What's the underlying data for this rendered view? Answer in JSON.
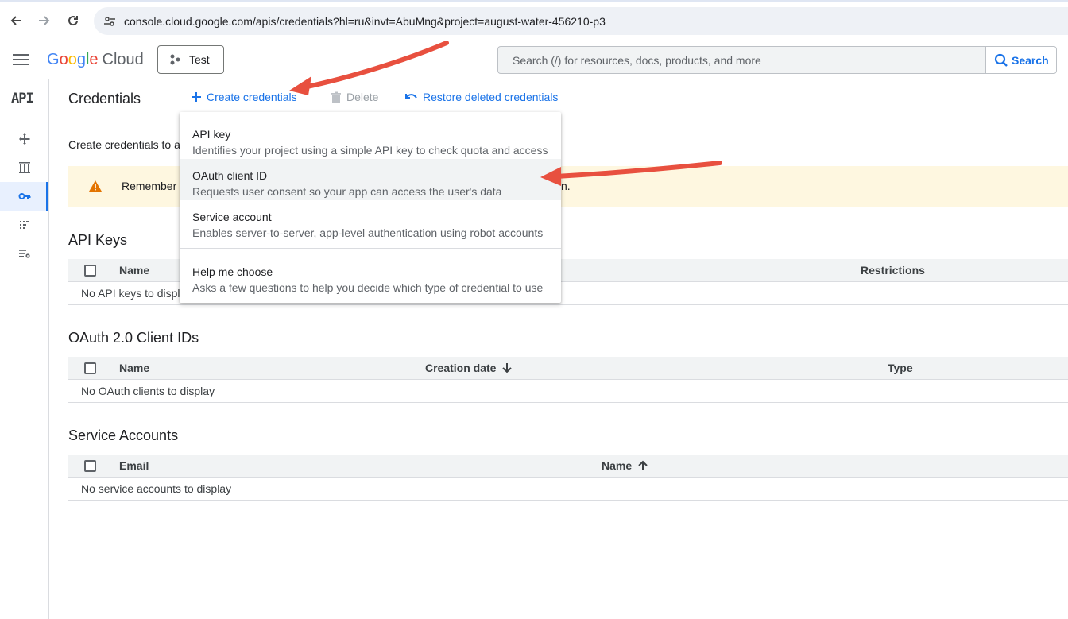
{
  "browser": {
    "url": "console.cloud.google.com/apis/credentials?hl=ru&invt=AbuMng&project=august-water-456210-p3"
  },
  "header": {
    "logo_letters": [
      "G",
      "o",
      "o",
      "g",
      "l",
      "e"
    ],
    "logo_product": "Cloud",
    "project_label": "Test",
    "search_placeholder": "Search (/) for resources, docs, products, and more",
    "search_button": "Search"
  },
  "rail": {
    "api_label": "API",
    "items": [
      "move-icon",
      "library-icon",
      "key-icon",
      "dots-grid-icon",
      "settings-list-icon"
    ],
    "active_index": 2
  },
  "toolbar": {
    "title": "Credentials",
    "create_label": "Create credentials",
    "delete_label": "Delete",
    "restore_label": "Restore deleted credentials"
  },
  "intro": "Create credentials to a",
  "banner": {
    "text": "Remember t",
    "tail": "n.",
    "accent": "#e37400"
  },
  "api_keys": {
    "title": "API Keys",
    "columns": [
      "Name",
      "Restrictions"
    ],
    "empty": "No API keys to displ"
  },
  "oauth": {
    "title": "OAuth 2.0 Client IDs",
    "columns": [
      "Name",
      "Creation date",
      "Type"
    ],
    "empty": "No OAuth clients to display"
  },
  "service_accounts": {
    "title": "Service Accounts",
    "columns": [
      "Email",
      "Name"
    ],
    "empty": "No service accounts to display"
  },
  "menu": {
    "items": [
      {
        "title": "API key",
        "desc": "Identifies your project using a simple API key to check quota and access"
      },
      {
        "title": "OAuth client ID",
        "desc": "Requests user consent so your app can access the user's data"
      },
      {
        "title": "Service account",
        "desc": "Enables server-to-server, app-level authentication using robot accounts"
      },
      {
        "title": "Help me choose",
        "desc": "Asks a few questions to help you decide which type of credential to use"
      }
    ],
    "highlighted_index": 1
  },
  "colors": {
    "accent": "#1a73e8",
    "annotation_arrow": "#e8503f",
    "banner_bg": "#fef7e0"
  }
}
